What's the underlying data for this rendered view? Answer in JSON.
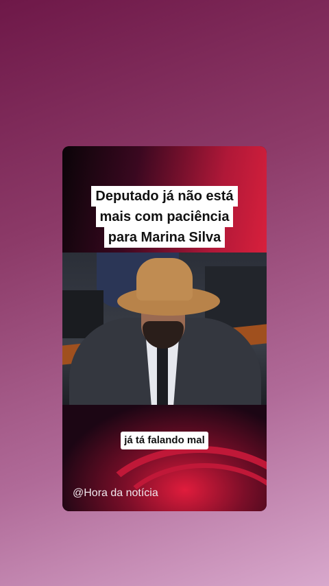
{
  "headline": {
    "lines": [
      "Deputado já não está",
      "mais com paciência",
      "para Marina Silva"
    ]
  },
  "caption": "já tá falando mal",
  "watermark": "@Hora da notícia"
}
